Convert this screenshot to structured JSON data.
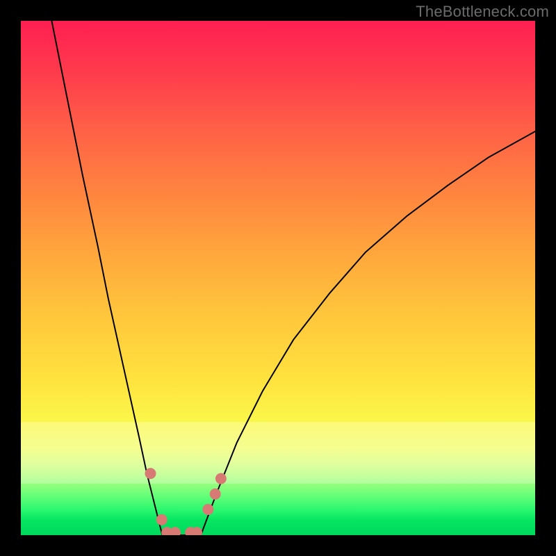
{
  "watermark": "TheBottleneck.com",
  "chart_data": {
    "type": "line",
    "title": "",
    "xlabel": "",
    "ylabel": "",
    "xlim": [
      0,
      100
    ],
    "ylim": [
      0,
      100
    ],
    "grid": false,
    "series": [
      {
        "name": "left-branch",
        "x": [
          6,
          9,
          12,
          15,
          17,
          19,
          21,
          23,
          24.5,
          26,
          27.5
        ],
        "y": [
          100,
          85,
          70,
          56,
          46,
          37,
          28,
          19,
          12,
          6,
          0
        ]
      },
      {
        "name": "valley-floor",
        "x": [
          27.5,
          29,
          31,
          33,
          35
        ],
        "y": [
          0,
          0,
          0,
          0,
          0
        ]
      },
      {
        "name": "right-branch",
        "x": [
          35,
          38,
          42,
          47,
          53,
          60,
          67,
          75,
          83,
          91,
          100
        ],
        "y": [
          0,
          8,
          18,
          28,
          38,
          47,
          55,
          62,
          68,
          73.5,
          78.5
        ]
      }
    ],
    "markers": [
      {
        "name": "left-marker-upper",
        "x": 25.2,
        "y": 12
      },
      {
        "name": "left-marker-lower",
        "x": 27.4,
        "y": 3
      },
      {
        "name": "floor-marker-a",
        "x": 28.4,
        "y": 0.5
      },
      {
        "name": "floor-marker-b",
        "x": 30.0,
        "y": 0.5
      },
      {
        "name": "floor-marker-c",
        "x": 33.0,
        "y": 0.5
      },
      {
        "name": "floor-marker-d",
        "x": 34.2,
        "y": 0.5
      },
      {
        "name": "right-marker-a",
        "x": 36.4,
        "y": 5
      },
      {
        "name": "right-marker-b",
        "x": 37.8,
        "y": 8
      },
      {
        "name": "right-marker-c",
        "x": 38.9,
        "y": 11
      }
    ],
    "marker_style": {
      "color": "#d77a74",
      "radius_px": 8
    },
    "pale_band": {
      "top_pct": 78,
      "bottom_pct": 90
    }
  }
}
